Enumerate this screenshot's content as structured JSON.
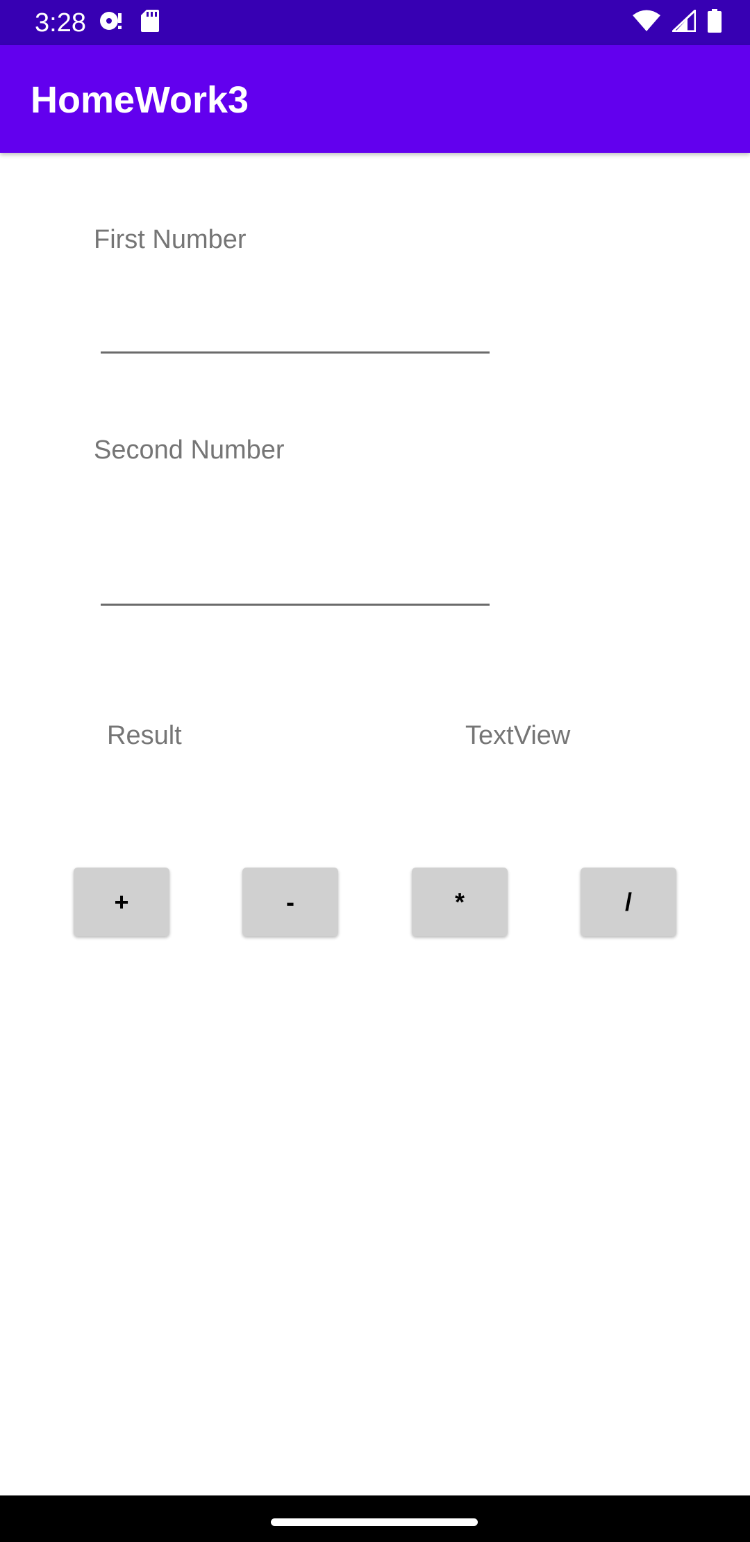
{
  "status_bar": {
    "time": "3:28",
    "left_icons": [
      "media-icon",
      "sd-card-icon"
    ],
    "right_icons": [
      "wifi-icon",
      "cell-signal-icon",
      "battery-icon"
    ],
    "background": "#3700b3"
  },
  "app_bar": {
    "title": "HomeWork3",
    "background": "#6200ee"
  },
  "form": {
    "first_number_label": "First Number",
    "first_number_value": "",
    "second_number_label": "Second Number",
    "second_number_value": "",
    "result_label": "Result",
    "result_value": "TextView"
  },
  "buttons": {
    "add": "+",
    "subtract": "-",
    "multiply": "*",
    "divide": "/"
  },
  "colors": {
    "button_background": "#d0d0d0",
    "label_text": "#757575"
  }
}
